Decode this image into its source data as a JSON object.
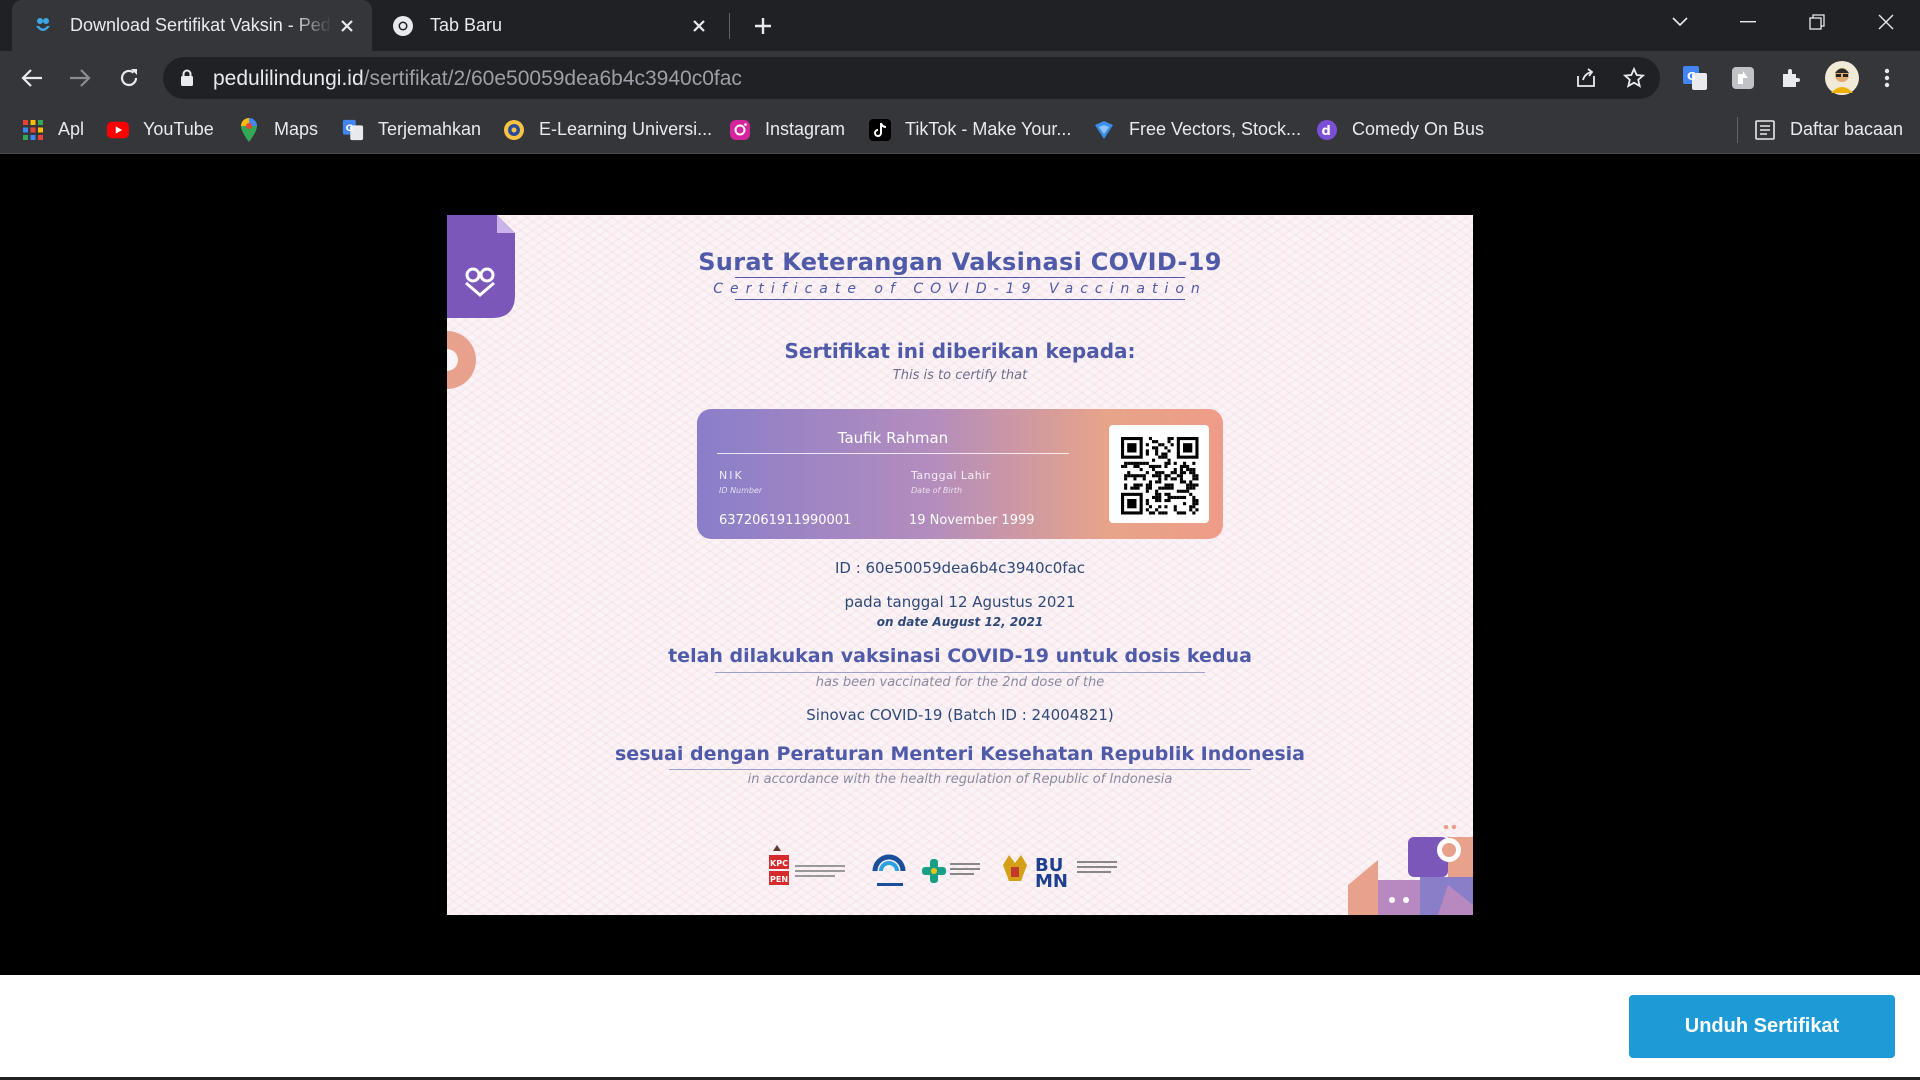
{
  "browser": {
    "tabs": [
      {
        "title": "Download Sertifikat Vaksin - Pedulilindungi",
        "active": true
      },
      {
        "title": "Tab Baru",
        "active": false
      }
    ],
    "url": {
      "host": "pedulilindungi.id",
      "path": "/sertifikat/2/60e50059dea6b4c3940c0fac"
    },
    "bookmarks": [
      {
        "label": "Apl",
        "icon": "apps-grid-icon"
      },
      {
        "label": "YouTube",
        "icon": "youtube-icon"
      },
      {
        "label": "Maps",
        "icon": "maps-icon"
      },
      {
        "label": "Terjemahkan",
        "icon": "translate-icon"
      },
      {
        "label": "E-Learning Universi...",
        "icon": "university-icon"
      },
      {
        "label": "Instagram",
        "icon": "instagram-icon"
      },
      {
        "label": "TikTok - Make Your...",
        "icon": "tiktok-icon"
      },
      {
        "label": "Free Vectors, Stock...",
        "icon": "vector-site-icon"
      },
      {
        "label": "Comedy On Bus",
        "icon": "comedy-icon"
      }
    ],
    "reading_list": "Daftar bacaan"
  },
  "certificate": {
    "title": "Surat Keterangan Vaksinasi COVID-19",
    "subtitle": "Certificate of COVID-19 Vaccination",
    "given_to": "Sertifikat ini diberikan kepada:",
    "given_to_en": "This is to certify that",
    "holder": {
      "name": "Taufik Rahman",
      "nik_label": "NIK",
      "nik_label_en": "ID Number",
      "nik": "6372061911990001",
      "dob_label": "Tanggal Lahir",
      "dob_label_en": "Date of Birth",
      "dob": "19 November 1999"
    },
    "id_line": "ID : 60e50059dea6b4c3940c0fac",
    "date_line": "pada tanggal 12 Agustus 2021",
    "date_line_en": "on date August 12, 2021",
    "vaccinated": "telah dilakukan vaksinasi COVID-19 untuk dosis kedua",
    "vaccinated_en": "has been vaccinated for the 2nd dose of the",
    "batch": "Sinovac COVID-19 (Batch ID : 24004821)",
    "regulation": "sesuai dengan Peraturan Menteri Kesehatan Republik Indonesia",
    "regulation_en": "in accordance with the health regulation of Republic of Indonesia",
    "logos": [
      "KPC PEN",
      "KOMINFO",
      "Kementerian Kesehatan",
      "Garuda",
      "BUMN"
    ]
  },
  "actions": {
    "download": "Unduh Sertifikat"
  },
  "colors": {
    "accent": "#1e9bd7",
    "cert_title": "#4f5aa8",
    "chrome_bg": "#202124",
    "toolbar_bg": "#35363a"
  }
}
